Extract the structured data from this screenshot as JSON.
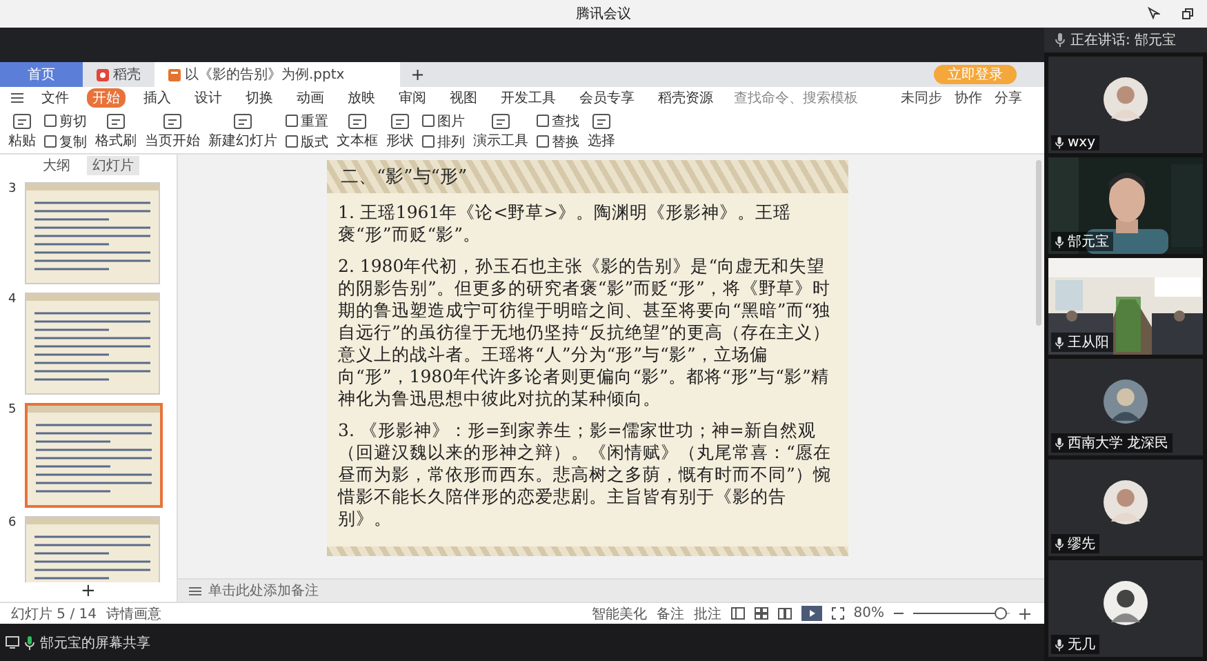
{
  "window": {
    "title": "腾讯会议"
  },
  "wps": {
    "tabs": [
      {
        "label": "首页",
        "kind": "home",
        "selected": false
      },
      {
        "label": "稻壳",
        "kind": "store",
        "selected": false
      },
      {
        "label": "以《影的告别》为例.pptx",
        "kind": "file",
        "selected": true
      }
    ],
    "new_tab": "+",
    "add_slide": "+",
    "login_button": "立即登录",
    "menu": [
      {
        "label": "文件",
        "selected": false
      },
      {
        "label": "开始",
        "selected": true
      },
      {
        "label": "插入",
        "selected": false
      },
      {
        "label": "设计",
        "selected": false
      },
      {
        "label": "切换",
        "selected": false
      },
      {
        "label": "动画",
        "selected": false
      },
      {
        "label": "放映",
        "selected": false
      },
      {
        "label": "审阅",
        "selected": false
      },
      {
        "label": "视图",
        "selected": false
      },
      {
        "label": "开发工具",
        "selected": false
      },
      {
        "label": "会员专享",
        "selected": false
      },
      {
        "label": "稻壳资源",
        "selected": false
      }
    ],
    "search": {
      "placeholder": "查找命令、搜索模板"
    },
    "actions": [
      "未同步",
      "协作",
      "分享"
    ],
    "ribbon": [
      [
        {
          "label": "粘贴",
          "kind": "large"
        }
      ],
      [
        {
          "label": "剪切",
          "kind": "small"
        },
        {
          "label": "复制",
          "kind": "small"
        }
      ],
      [
        {
          "label": "格式刷",
          "kind": "large"
        }
      ],
      [
        {
          "label": "当页开始",
          "kind": "large"
        }
      ],
      [
        {
          "label": "新建幻灯片",
          "kind": "large"
        }
      ],
      [
        {
          "label": "重置",
          "kind": "small"
        },
        {
          "label": "版式",
          "kind": "small"
        }
      ],
      [
        {
          "label": "文本框",
          "kind": "large"
        }
      ],
      [
        {
          "label": "形状",
          "kind": "large"
        }
      ],
      [
        {
          "label": "图片",
          "kind": "small"
        },
        {
          "label": "排列",
          "kind": "small"
        }
      ],
      [
        {
          "label": "演示工具",
          "kind": "large"
        }
      ],
      [
        {
          "label": "查找",
          "kind": "small"
        },
        {
          "label": "替换",
          "kind": "small"
        }
      ],
      [
        {
          "label": "选择",
          "kind": "large"
        }
      ]
    ],
    "panel_tabs": [
      {
        "label": "大纲",
        "selected": false
      },
      {
        "label": "幻灯片",
        "selected": true
      }
    ],
    "thumbnails": [
      {
        "number": "3",
        "selected": false
      },
      {
        "number": "4",
        "selected": false
      },
      {
        "number": "5",
        "selected": true
      },
      {
        "number": "6",
        "selected": false
      }
    ],
    "slide": {
      "title": "二、“影”与“形”",
      "paragraphs": [
        "1. 王瑶1961年《论<野草>》。陶渊明《形影神》。王瑶褒“形”而贬“影”。",
        "2. 1980年代初，孙玉石也主张《影的告别》是“向虚无和失望的阴影告别”。但更多的研究者褒“影”而贬“形”，将《野草》时期的鲁迅塑造成宁可彷徨于明暗之间、甚至将要向“黑暗”而“独自远行”的虽彷徨于无地仍坚持“反抗绝望”的更高（存在主义）意义上的战斗者。王瑶将“人”分为“形”与“影”，立场偏向“形”，1980年代许多论者则更偏向“影”。都将“形”与“影”精神化为鲁迅思想中彼此对抗的某种倾向。",
        "3. 《形影神》：形=到家养生；影=儒家世功；神=新自然观（回避汉魏以来的形神之辩）。《闲情赋》（丸尾常喜：“愿在昼而为影，常依形而西东。悲高树之多荫，慨有时而不同”）惋惜影不能长久陪伴形的恋爱悲剧。主旨皆有别于《影的告别》。"
      ]
    },
    "notes_placeholder": "单击此处添加备注",
    "status": {
      "slide_count": "幻灯片 5 / 14",
      "theme": "诗情画意",
      "beautify": "智能美化",
      "notes": "备注",
      "comments": "批注",
      "zoom": "80%",
      "zoom_slider": {
        "level": 0.9
      }
    }
  },
  "meeting": {
    "speaking": "正在讲话: 郜元宝",
    "participants": [
      {
        "name": "wxy",
        "kind": "avatar"
      },
      {
        "name": "郜元宝",
        "kind": "camera"
      },
      {
        "name": "王从阳",
        "kind": "room"
      },
      {
        "name": "西南大学 龙深民",
        "kind": "avatar"
      },
      {
        "name": "缪先",
        "kind": "avatar"
      },
      {
        "name": "无几",
        "kind": "avatar"
      }
    ],
    "share_label": "郜元宝的屏幕共享"
  }
}
